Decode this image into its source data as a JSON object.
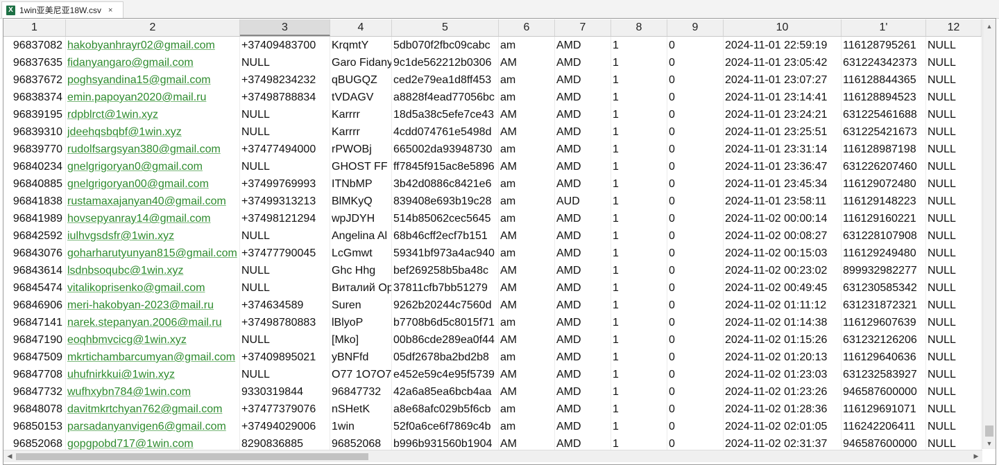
{
  "tab": {
    "title": "1win亚美尼亚18W.csv",
    "close": "×",
    "icon_letter": "X"
  },
  "columns": [
    "1",
    "2",
    "3",
    "4",
    "5",
    "6",
    "7",
    "8",
    "9",
    "10",
    "1'",
    "12"
  ],
  "selected_column": "3",
  "rows": [
    [
      "96837082",
      "hakobyanhrayr02@gmail.com",
      "+37409483700",
      "KrqmtY",
      "5db070f2fbc09cabc",
      "am",
      "AMD",
      "1",
      "0",
      "2024-11-01 22:59:19",
      "116128795261",
      "NULL"
    ],
    [
      "96837635",
      "fidanyangaro@gmail.com",
      "NULL",
      "Garo Fidany",
      "9c1de562212b0306",
      "AM",
      "AMD",
      "1",
      "0",
      "2024-11-01 23:05:42",
      "631224342373",
      "NULL"
    ],
    [
      "96837672",
      "poghsyandina15@gmail.com",
      "+37498234232",
      "qBUGQZ",
      "ced2e79ea1d8ff453",
      "am",
      "AMD",
      "1",
      "0",
      "2024-11-01 23:07:27",
      "116128844365",
      "NULL"
    ],
    [
      "96838374",
      "emin.papoyan2020@mail.ru",
      "+37498788834",
      "tVDAGV",
      "a8828f4ead77056bc",
      "am",
      "AMD",
      "1",
      "0",
      "2024-11-01 23:14:41",
      "116128894523",
      "NULL"
    ],
    [
      "96839195",
      "rdpblrct@1win.xyz",
      "NULL",
      "Karrrr",
      "18d5a38c5efe7ce43",
      "AM",
      "AMD",
      "1",
      "0",
      "2024-11-01 23:24:21",
      "631225461688",
      "NULL"
    ],
    [
      "96839310",
      "jdeehqsbqbf@1win.xyz",
      "NULL",
      "Karrrr",
      "4cdd074761e5498d",
      "AM",
      "AMD",
      "1",
      "0",
      "2024-11-01 23:25:51",
      "631225421673",
      "NULL"
    ],
    [
      "96839770",
      "rudolfsargsyan380@gmail.com",
      "+37477494000",
      "rPWOBj",
      "665002da93948730",
      "am",
      "AMD",
      "1",
      "0",
      "2024-11-01 23:31:14",
      "116128987198",
      "NULL"
    ],
    [
      "96840234",
      "gnelgrigoryan0@gmail.com",
      "NULL",
      "GHOST FF",
      "ff7845f915ac8e5896",
      "AM",
      "AMD",
      "1",
      "0",
      "2024-11-01 23:36:47",
      "631226207460",
      "NULL"
    ],
    [
      "96840885",
      "gnelgrigoryan00@gmail.com",
      "+37499769993",
      "ITNbMP",
      "3b42d0886c8421e6",
      "am",
      "AMD",
      "1",
      "0",
      "2024-11-01 23:45:34",
      "116129072480",
      "NULL"
    ],
    [
      "96841838",
      "rustamaxajanyan40@gmail.com",
      "+37499313213",
      "BlMKyQ",
      "839408e693b19c28",
      "am",
      "AUD",
      "1",
      "0",
      "2024-11-01 23:58:11",
      "116129148223",
      "NULL"
    ],
    [
      "96841989",
      "hovsepyanray14@gmail.com",
      "+37498121294",
      "wpJDYH",
      "514b85062cec5645",
      "am",
      "AMD",
      "1",
      "0",
      "2024-11-02 00:00:14",
      "116129160221",
      "NULL"
    ],
    [
      "96842592",
      "iulhvgsdsfr@1win.xyz",
      "NULL",
      "Angelina Al",
      "68b46cff2ecf7b151",
      "AM",
      "AMD",
      "1",
      "0",
      "2024-11-02 00:08:27",
      "631228107908",
      "NULL"
    ],
    [
      "96843076",
      "goharharutyunyan815@gmail.com",
      "+37477790045",
      "LcGmwt",
      "59341bf973a4ac940",
      "am",
      "AMD",
      "1",
      "0",
      "2024-11-02 00:15:03",
      "116129249480",
      "NULL"
    ],
    [
      "96843614",
      "lsdnbsoqubc@1win.xyz",
      "NULL",
      "Ghc Hhg",
      "bef269258b5ba48c",
      "AM",
      "AMD",
      "1",
      "0",
      "2024-11-02 00:23:02",
      "899932982277",
      "NULL"
    ],
    [
      "96845474",
      "vitalikoprisenko@gmail.com",
      "NULL",
      "Виталий Ора",
      "37811cfb7bb51279",
      "AM",
      "AMD",
      "1",
      "0",
      "2024-11-02 00:49:45",
      "631230585342",
      "NULL"
    ],
    [
      "96846906",
      "meri-hakobyan-2023@mail.ru",
      "+374634589",
      "Suren",
      "9262b20244c7560d",
      "AM",
      "AMD",
      "1",
      "0",
      "2024-11-02 01:11:12",
      "631231872321",
      "NULL"
    ],
    [
      "96847141",
      "narek.stepanyan.2006@mail.ru",
      "+37498780883",
      "lBlyoP",
      "b7708b6d5c8015f71",
      "am",
      "AMD",
      "1",
      "0",
      "2024-11-02 01:14:38",
      "116129607639",
      "NULL"
    ],
    [
      "96847190",
      "eoqhbmvcicg@1win.xyz",
      "NULL",
      "[Mko]",
      "00b86cde289ea0f44",
      "AM",
      "AMD",
      "1",
      "0",
      "2024-11-02 01:15:26",
      "631232126206",
      "NULL"
    ],
    [
      "96847509",
      "mkrtichambarcumyan@gmail.com",
      "+37409895021",
      "yBNFfd",
      "05df2678ba2bd2b8",
      "am",
      "AMD",
      "1",
      "0",
      "2024-11-02 01:20:13",
      "116129640636",
      "NULL"
    ],
    [
      "96847708",
      "uhufnirkkui@1win.xyz",
      "NULL",
      "O77 1O7O7",
      "e452e59c4e95f5739",
      "AM",
      "AMD",
      "1",
      "0",
      "2024-11-02 01:23:03",
      "631232583927",
      "NULL"
    ],
    [
      "96847732",
      "wufhxybn784@1win.com",
      "9330319844",
      "96847732",
      "42a6a85ea6bcb4aa",
      "AM",
      "AMD",
      "1",
      "0",
      "2024-11-02 01:23:26",
      "946587600000",
      "NULL"
    ],
    [
      "96848078",
      "davitmkrtchyan762@gmail.com",
      "+37477379076",
      "nSHetK",
      "a8e68afc029b5f6cb",
      "am",
      "AMD",
      "1",
      "0",
      "2024-11-02 01:28:36",
      "116129691071",
      "NULL"
    ],
    [
      "96850153",
      "parsadanyanvigen6@gmail.com",
      "+37494029006",
      "1win",
      "52f0a6ce6f7869c4b",
      "am",
      "AMD",
      "1",
      "0",
      "2024-11-02 02:01:05",
      "116242206411",
      "NULL"
    ],
    [
      "96852068",
      "gopgpobd717@1win.com",
      "8290836885",
      "96852068",
      "b996b931560b1904",
      "AM",
      "AMD",
      "1",
      "0",
      "2024-11-02 02:31:37",
      "946587600000",
      "NULL"
    ]
  ],
  "scroll": {
    "up": "▲",
    "down": "▼",
    "left": "◀",
    "right": "▶"
  }
}
